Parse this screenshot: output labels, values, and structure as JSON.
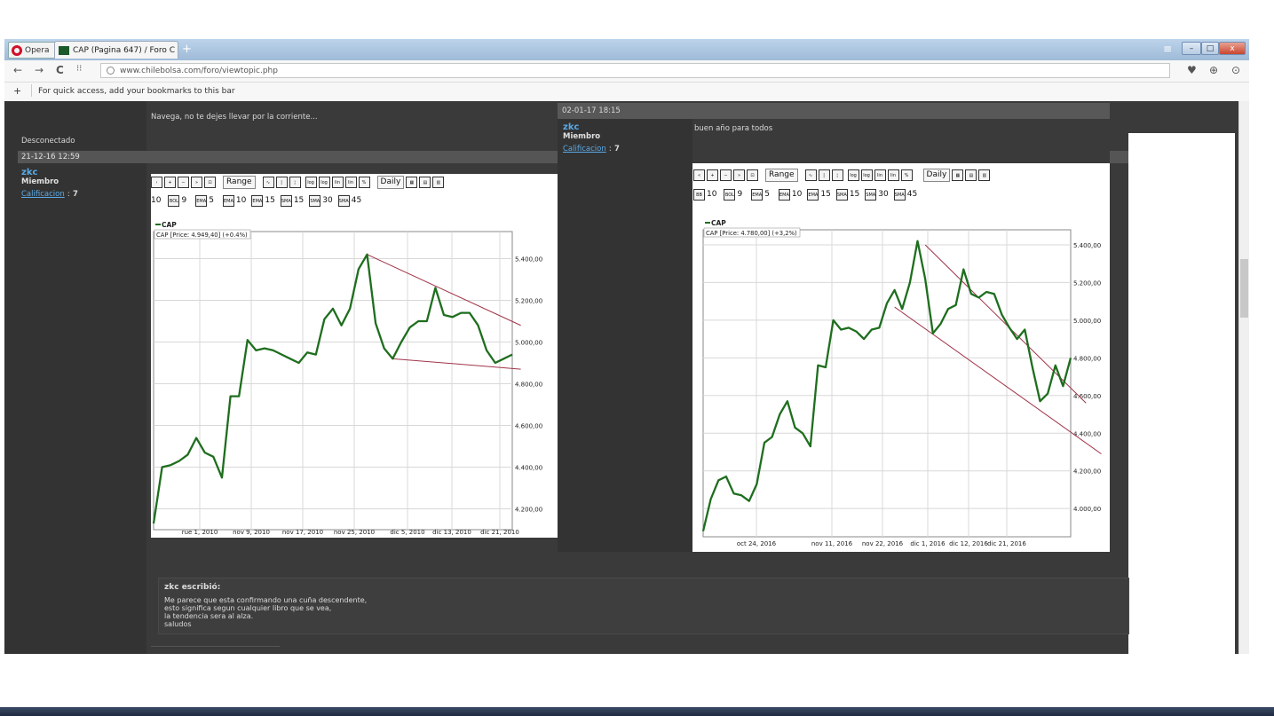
{
  "browser": {
    "opera_label": "Opera",
    "tab_title": "CAP (Pagina 647) / Foro C",
    "tab_close": "×",
    "new_tab": "+",
    "url": "www.chilebolsa.com/foro/viewtopic.php",
    "bookmarks_hint": "For quick access, add your bookmarks to this bar",
    "bookmarks_plus": "+",
    "back": "←",
    "forward": "→",
    "reload": "C",
    "speed_dial": "⁝⁝",
    "heart": "♥",
    "download": "⊕",
    "account": "⊙",
    "win_min": "–",
    "win_max": "□",
    "win_close": "x",
    "menu": "≡"
  },
  "forum": {
    "signature": "Navega, no te dejes llevar por la corriente...",
    "status": "Desconectado",
    "post1": {
      "date": "21-12-16 12:59",
      "user": "zkc",
      "role": "Miembro",
      "rating_label": "Calificacion",
      "rating_sep": ":",
      "rating": "7"
    },
    "post2": {
      "date": "02-01-17 18:15",
      "user": "zkc",
      "role": "Miembro",
      "rating_label": "Calificacion",
      "rating_sep": ":",
      "rating": "7",
      "message": "buen año para todos"
    },
    "quote": {
      "author": "zkc escribió:",
      "line1": "Me parece que esta confirmando una cuña descendente,",
      "line2": "esto significa segun cualquier libro que se vea,",
      "line3": "la tendencia sera al alza.",
      "line4": "saludos"
    }
  },
  "toolbar": {
    "range": "Range",
    "daily": "Daily",
    "ind1": [
      "10",
      "9",
      "5",
      "10",
      "15",
      "15",
      "30",
      "45"
    ]
  },
  "chart_data": [
    {
      "type": "line",
      "series": [
        {
          "name": "CAP",
          "values": [
            4130,
            4400,
            4410,
            4430,
            4460,
            4540,
            4470,
            4450,
            4350,
            4740,
            4740,
            5010,
            4960,
            4970,
            4960,
            4940,
            4920,
            4900,
            4950,
            4940,
            5110,
            5160,
            5080,
            5160,
            5350,
            5420,
            5090,
            4970,
            4920,
            5000,
            5070,
            5100,
            5100,
            5260,
            5130,
            5120,
            5140,
            5140,
            5080,
            4960,
            4900,
            4920,
            4940
          ]
        }
      ],
      "legend_label": "CAP",
      "price_label": "CAP [Price: 4.949,40] (+0.4%)",
      "x_ticks": [
        "rue 1, 2010",
        "nov 9, 2010",
        "nov 17, 2010",
        "nov 25, 2010",
        "dic 5, 2010",
        "dic 13, 2010",
        "dic 21, 2010"
      ],
      "y_ticks": [
        "5.400,00",
        "5.200,00",
        "5.000,00",
        "4.800,00",
        "4.600,00",
        "4.400,00",
        "4.200,00"
      ],
      "ylim": [
        4100,
        5530
      ],
      "grid": true,
      "trendlines": [
        {
          "from": [
            25,
            5420
          ],
          "to": [
            43,
            5080
          ]
        },
        {
          "from": [
            28,
            4920
          ],
          "to": [
            43,
            4870
          ]
        }
      ]
    },
    {
      "type": "line",
      "series": [
        {
          "name": "CAP",
          "values": [
            3880,
            4050,
            4150,
            4170,
            4080,
            4070,
            4040,
            4130,
            4350,
            4380,
            4500,
            4570,
            4430,
            4400,
            4330,
            4760,
            4750,
            5000,
            4950,
            4960,
            4940,
            4900,
            4950,
            4960,
            5090,
            5160,
            5060,
            5200,
            5420,
            5220,
            4930,
            4980,
            5060,
            5080,
            5270,
            5140,
            5120,
            5150,
            5140,
            5030,
            4960,
            4900,
            4950,
            4750,
            4570,
            4610,
            4760,
            4650,
            4800
          ]
        }
      ],
      "legend_label": "CAP",
      "price_label": "CAP [Price: 4.780,00] (+3,2%)",
      "x_ticks": [
        "oct 24, 2016",
        "nov 11, 2016",
        "nov 22, 2016",
        "dic 1, 2016",
        "dic 12, 2016",
        "dic 21, 2016"
      ],
      "y_ticks": [
        "5.400,00",
        "5.200,00",
        "5.000,00",
        "4.800,00",
        "4.600,00",
        "4.400,00",
        "4.200,00",
        "4.000,00"
      ],
      "ylim": [
        3850,
        5480
      ],
      "grid": true,
      "trendlines": [
        {
          "from": [
            29,
            5400
          ],
          "to": [
            50,
            4560
          ]
        },
        {
          "from": [
            25,
            5070
          ],
          "to": [
            52,
            4290
          ]
        }
      ]
    }
  ]
}
